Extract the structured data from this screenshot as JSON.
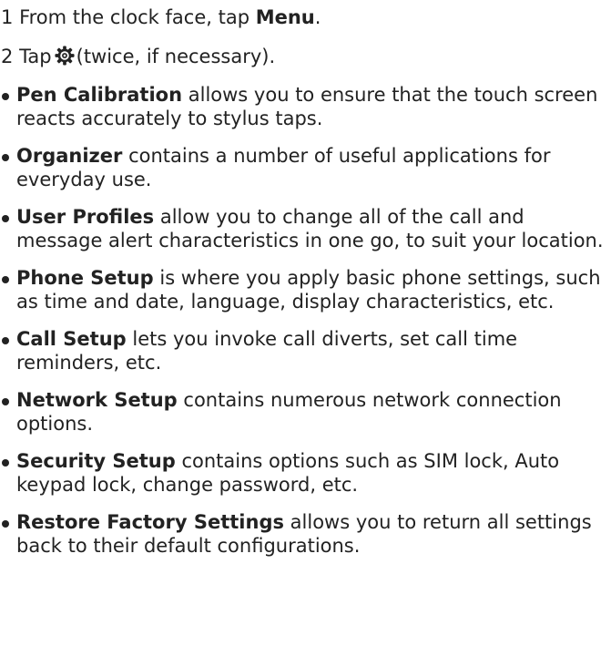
{
  "steps": [
    {
      "number": "1",
      "before": "From the clock face, tap",
      "emphasis": "Menu",
      "after": "."
    },
    {
      "number": "2",
      "before": "Tap",
      "icon": "settings-gear-icon",
      "after": "(twice, if necessary)."
    }
  ],
  "bullets": [
    {
      "term": "Pen Calibration",
      "text": "allows you to ensure that the touch screen reacts accurately to stylus taps."
    },
    {
      "term": "Organizer",
      "text": "contains a number of useful applications for everyday use."
    },
    {
      "term": "User Profiles",
      "text": "allow you to change all of the call and message alert characteristics in one go, to suit your location."
    },
    {
      "term": "Phone Setup",
      "text": "is where you apply basic phone settings, such as time and date, language, display characteristics, etc."
    },
    {
      "term": "Call Setup",
      "text": "lets you invoke call diverts, set call time reminders, etc."
    },
    {
      "term": "Network Setup",
      "text": "contains numerous network connection options."
    },
    {
      "term": "Security Setup",
      "text": "contains options such as SIM lock, Auto keypad lock, change password, etc."
    },
    {
      "term": "Restore Factory Settings",
      "text": "allows you to return all settings back to their default configurations."
    }
  ]
}
